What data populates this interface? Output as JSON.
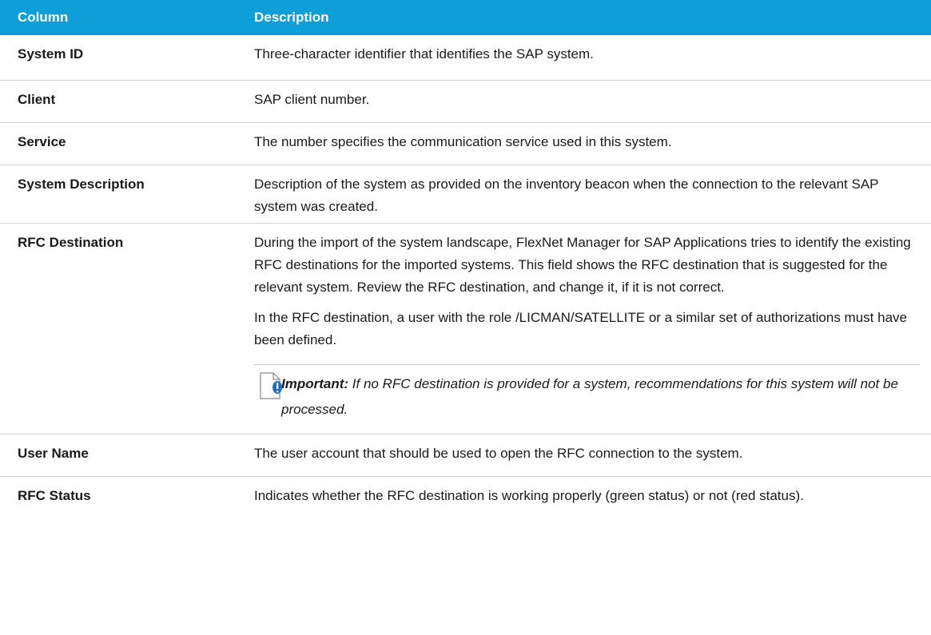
{
  "table": {
    "headers": [
      "Column",
      "Description"
    ],
    "rows": [
      {
        "name": "System ID",
        "desc": [
          "Three-character identifier that identifies the SAP system."
        ]
      },
      {
        "name": "Client",
        "desc": [
          "SAP client number."
        ]
      },
      {
        "name": "Service",
        "desc": [
          "The number specifies the communication service used in this system."
        ]
      },
      {
        "name": "System Description",
        "desc": [
          "Description of the system as provided on the inventory beacon when the connection to the relevant SAP system was created."
        ]
      },
      {
        "name": "RFC Destination",
        "desc": [
          "During the import of the system landscape, FlexNet Manager for SAP Applications tries to identify the existing RFC destinations for the imported systems. This field shows the RFC destination that is suggested for the relevant system. Review the RFC destination, and change it, if it is not correct.",
          "In the RFC destination, a user with the role /LICMAN/SATELLITE or a similar set of authorizations must have been defined."
        ],
        "note": {
          "label": "Important:",
          "text": "If no RFC destination is provided for a system, recommendations for this system will not be processed.",
          "icon": "important-note-icon"
        }
      },
      {
        "name": "User Name",
        "desc": [
          "The user account that should be used to open the RFC connection to the system."
        ]
      },
      {
        "name": "RFC Status",
        "desc": [
          "Indicates whether the RFC destination is working properly (green status) or not (red status)."
        ]
      }
    ]
  },
  "colors": {
    "header_bg": "#0e9fd9",
    "header_text": "#ffffff",
    "row_border": "#d2d2d2",
    "icon_accent": "#1a73c8"
  }
}
